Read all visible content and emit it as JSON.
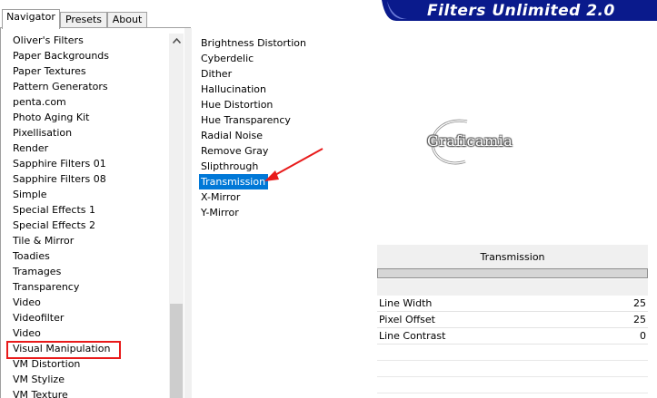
{
  "tabs": [
    {
      "label": "Navigator"
    },
    {
      "label": "Presets"
    },
    {
      "label": "About"
    }
  ],
  "banner": {
    "title": "Filters Unlimited 2.0",
    "color": "#0a1a8c"
  },
  "navigator": {
    "items": [
      {
        "label": "Oliver's Filters"
      },
      {
        "label": "Paper Backgrounds"
      },
      {
        "label": "Paper Textures"
      },
      {
        "label": "Pattern Generators"
      },
      {
        "label": "penta.com"
      },
      {
        "label": "Photo Aging Kit"
      },
      {
        "label": "Pixellisation"
      },
      {
        "label": "Render"
      },
      {
        "label": "Sapphire Filters 01"
      },
      {
        "label": "Sapphire Filters 08"
      },
      {
        "label": "Simple"
      },
      {
        "label": "Special Effects 1"
      },
      {
        "label": "Special Effects 2"
      },
      {
        "label": "Tile & Mirror"
      },
      {
        "label": "Toadies"
      },
      {
        "label": "Tramages"
      },
      {
        "label": "Transparency"
      },
      {
        "label": "Video"
      },
      {
        "label": "Videofilter"
      },
      {
        "label": "Video"
      },
      {
        "label": "Visual Manipulation"
      },
      {
        "label": "VM Distortion"
      },
      {
        "label": "VM Stylize"
      },
      {
        "label": "VM Texture"
      }
    ],
    "highlighted": "Visual Manipulation",
    "highlight_color": "#e81a1a"
  },
  "filters": {
    "items": [
      {
        "label": "Brightness Distortion"
      },
      {
        "label": "Cyberdelic"
      },
      {
        "label": "Dither"
      },
      {
        "label": "Hallucination"
      },
      {
        "label": "Hue Distortion"
      },
      {
        "label": "Hue Transparency"
      },
      {
        "label": "Radial Noise"
      },
      {
        "label": "Remove Gray"
      },
      {
        "label": "Slipthrough"
      },
      {
        "label": "Transmission"
      },
      {
        "label": "X-Mirror"
      },
      {
        "label": "Y-Mirror"
      }
    ],
    "selected": "Transmission",
    "selection_color": "#0078d7"
  },
  "preview": {
    "watermark": "Graficamia"
  },
  "parameters": {
    "title": "Transmission",
    "rows": [
      {
        "label": "Line Width",
        "value": "25"
      },
      {
        "label": "Pixel Offset",
        "value": "25"
      },
      {
        "label": "Line Contrast",
        "value": "0"
      }
    ]
  }
}
